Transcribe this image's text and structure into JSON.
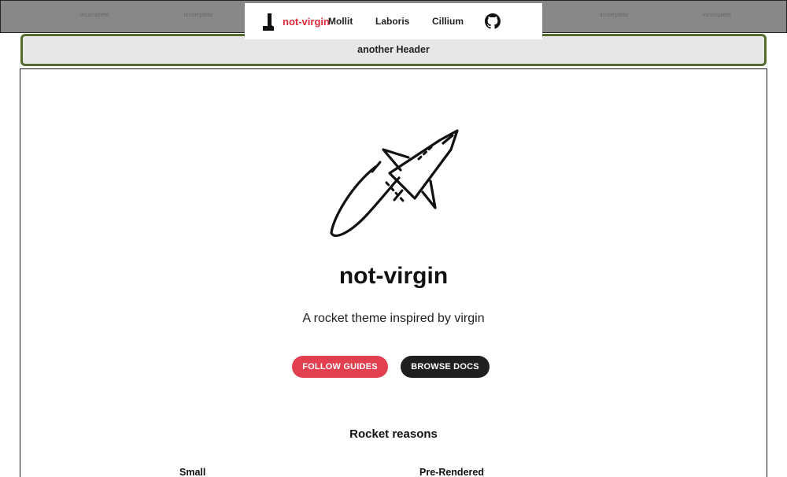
{
  "nav": {
    "brand": "not-virgin",
    "links": [
      "Mollit",
      "Laboris",
      "Cillium"
    ],
    "logo_icon": "boot-icon",
    "github_icon": "github-icon"
  },
  "subheader": {
    "title": "another Header",
    "badges": [
      "incomplete",
      "incomplete",
      "incomplete",
      "incomplete",
      "incomplete",
      "incomplete",
      "incomplete"
    ]
  },
  "hero": {
    "image_icon": "rocket-icon",
    "title": "not-virgin",
    "subtitle": "A rocket theme inspired by virgin",
    "primary_button": "FOLLOW GUIDES",
    "secondary_button": "BROWSE DOCS"
  },
  "reasons": {
    "title": "Rocket reasons",
    "items": [
      "Small",
      "Pre-Rendered"
    ]
  },
  "colors": {
    "accent": "#e2404f",
    "dark": "#1f1f1f",
    "topbar": "#888888",
    "subheader_border": "#556b2f"
  }
}
